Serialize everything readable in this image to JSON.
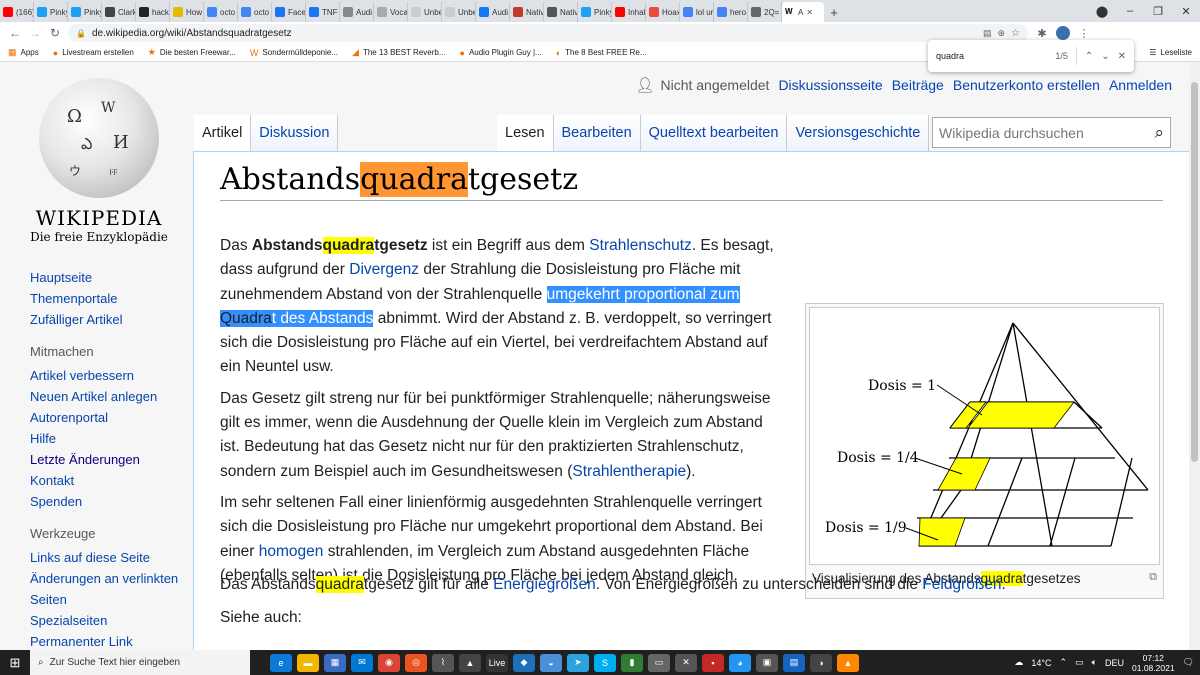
{
  "browser": {
    "tabs": [
      {
        "label": "(166)",
        "color": "#ff0000"
      },
      {
        "label": "Pinky",
        "color": "#1da1f2"
      },
      {
        "label": "Pinky",
        "color": "#1da1f2"
      },
      {
        "label": "Clark",
        "color": "#444444"
      },
      {
        "label": "hack",
        "color": "#222222"
      },
      {
        "label": "How",
        "color": "#e6b800"
      },
      {
        "label": "octo",
        "color": "#4285f4"
      },
      {
        "label": "octo",
        "color": "#4285f4"
      },
      {
        "label": "Faceb",
        "color": "#1877f2"
      },
      {
        "label": "TNF I",
        "color": "#1877f2"
      },
      {
        "label": "Audi",
        "color": "#888888"
      },
      {
        "label": "Vocal",
        "color": "#aaaaaa"
      },
      {
        "label": "Unbe",
        "color": "#cccccc"
      },
      {
        "label": "Unbe",
        "color": "#cccccc"
      },
      {
        "label": "Audi",
        "color": "#1877f2"
      },
      {
        "label": "Nativ",
        "color": "#c0392b"
      },
      {
        "label": "Nativ",
        "color": "#555555"
      },
      {
        "label": "Pinky",
        "color": "#1da1f2"
      },
      {
        "label": "Inhalt",
        "color": "#ff0000"
      },
      {
        "label": "Hoax",
        "color": "#e74c3c"
      },
      {
        "label": "lol ur",
        "color": "#4285f4"
      },
      {
        "label": "hero",
        "color": "#4285f4"
      },
      {
        "label": "2Q=",
        "color": "#666666"
      }
    ],
    "active_tab": {
      "label": "A",
      "icon": "W"
    },
    "url": "de.wikipedia.org/wiki/Abstandsquadratgesetz",
    "bookmarks": [
      {
        "label": "Apps",
        "icon": "▦"
      },
      {
        "label": "Livestream erstellen",
        "icon": "●"
      },
      {
        "label": "Die besten Freewar...",
        "icon": "★"
      },
      {
        "label": "Sondermülldeponie...",
        "icon": "W"
      },
      {
        "label": "The 13 BEST Reverb...",
        "icon": "◢"
      },
      {
        "label": "Audio Plugin Guy |...",
        "icon": "●"
      },
      {
        "label": "The 8 Best FREE Re...",
        "icon": "◐"
      }
    ],
    "reading_list": "Leseliste",
    "find": {
      "query": "quadra",
      "count": "1/5"
    }
  },
  "wiki": {
    "logo_title": "WIKIPEDIA",
    "logo_subtitle": "Die freie Enzyklopädie",
    "nav_main": [
      "Hauptseite",
      "Themenportale",
      "Zufälliger Artikel"
    ],
    "mitmachen_heading": "Mitmachen",
    "nav_mitmachen": [
      "Artikel verbessern",
      "Neuen Artikel anlegen",
      "Autorenportal",
      "Hilfe",
      "Letzte Änderungen",
      "Kontakt",
      "Spenden"
    ],
    "werkzeuge_heading": "Werkzeuge",
    "nav_werkzeuge": [
      "Links auf diese Seite",
      "Änderungen an verlinkten Seiten",
      "Spezialseiten",
      "Permanenter Link"
    ],
    "user": {
      "status": "Nicht angemeldet",
      "links": [
        "Diskussionsseite",
        "Beiträge",
        "Benutzerkonto erstellen",
        "Anmelden"
      ]
    },
    "tabs_left": [
      "Artikel",
      "Diskussion"
    ],
    "tabs_right": [
      "Lesen",
      "Bearbeiten",
      "Quelltext bearbeiten",
      "Versionsgeschichte"
    ],
    "search_placeholder": "Wikipedia durchsuchen",
    "title": {
      "pre": "Abstands",
      "hit": "quadra",
      "post": "tgesetz"
    }
  },
  "article": {
    "p1": {
      "a": "Das ",
      "b_pre": "Abstands",
      "b_hit": "quadra",
      "b_post": "tgesetz",
      "c": " ist ein Begriff aus dem ",
      "link1": "Strahlenschutz",
      "d": ". Es besagt, dass aufgrund der ",
      "link2": "Divergenz",
      "e": " der Strahlung die Dosisleistung pro Fläche mit zunehmendem Abstand von der Strahlenquelle ",
      "sel1": "umgekehrt proportional zum ",
      "sel_hit": "Quadra",
      "sel2": "t des Abstands",
      "f": " abnimmt. Wird der Abstand z. B. verdoppelt, so verringert sich die Dosisleistung pro Fläche auf ein Viertel, bei verdreifachtem Abstand auf ein Neuntel usw."
    },
    "p2": {
      "a": "Das Gesetz gilt streng nur für bei punktförmiger Strahlenquelle; näherungsweise gilt es immer, wenn die Ausdehnung der Quelle klein im Vergleich zum Abstand ist. Bedeutung hat das Gesetz nicht nur für den praktizierten Strahlenschutz, sondern zum Beispiel auch im Gesundheitswesen (",
      "link": "Strahlentherapie",
      "b": ")."
    },
    "p3": {
      "a": "Im sehr seltenen Fall einer linienförmig ausgedehnten Strahlenquelle verringert sich die Dosisleistung pro Fläche nur umgekehrt proportional dem Abstand. Bei einer ",
      "link": "homogen",
      "b": " strahlenden, im Vergleich zum Abstand ausgedehnten Fläche (ebenfalls selten) ist die Dosisleistung pro Fläche bei jedem Abstand gleich."
    },
    "p4": {
      "a": "Das Abstands",
      "hit": "quadra",
      "b": "tgesetz gilt für alle ",
      "link1": "Energiegrößen",
      "c": ". Von Energiegrößen zu unterscheiden sind die ",
      "link2": "Feldgrößen",
      "d": "."
    },
    "siehe": "Siehe auch:",
    "figure": {
      "labels": [
        "Dosis = 1",
        "Dosis = 1/4",
        "Dosis = 1/9"
      ],
      "caption_pre": "Visualisierung des Abstands",
      "caption_hit": "quadra",
      "caption_post": "tgesetzes",
      "fill": "#ffff00"
    }
  },
  "taskbar": {
    "search_placeholder": "Zur Suche Text hier eingeben",
    "weather": "14°C",
    "lang": "DEU",
    "time": "07:12",
    "date": "01.08.2021",
    "apps": [
      {
        "name": "edge",
        "color": "#0c7bd8",
        "glyph": "e"
      },
      {
        "name": "explorer",
        "color": "#f2b500",
        "glyph": "▬"
      },
      {
        "name": "store",
        "color": "#3a6bc4",
        "glyph": "▦"
      },
      {
        "name": "mail",
        "color": "#0078d4",
        "glyph": "✉"
      },
      {
        "name": "chrome",
        "color": "#db4437",
        "glyph": "◉"
      },
      {
        "name": "ubuntu",
        "color": "#e95420",
        "glyph": "◎"
      },
      {
        "name": "app7",
        "color": "#555555",
        "glyph": "⌇"
      },
      {
        "name": "app8",
        "color": "#444444",
        "glyph": "▲"
      },
      {
        "name": "live",
        "color": "#333333",
        "glyph": "Live"
      },
      {
        "name": "app10",
        "color": "#1d6fb8",
        "glyph": "◆"
      },
      {
        "name": "app11",
        "color": "#4a90d9",
        "glyph": "◒"
      },
      {
        "name": "telegram",
        "color": "#2aa3de",
        "glyph": "➤"
      },
      {
        "name": "skype",
        "color": "#00aff0",
        "glyph": "S"
      },
      {
        "name": "app14",
        "color": "#2e7d32",
        "glyph": "▮"
      },
      {
        "name": "app15",
        "color": "#666666",
        "glyph": "▭"
      },
      {
        "name": "app16",
        "color": "#555555",
        "glyph": "✕"
      },
      {
        "name": "app17",
        "color": "#c62828",
        "glyph": "▪"
      },
      {
        "name": "app18",
        "color": "#2196f3",
        "glyph": "◕"
      },
      {
        "name": "app19",
        "color": "#555555",
        "glyph": "▣"
      },
      {
        "name": "app20",
        "color": "#1565c0",
        "glyph": "▤"
      },
      {
        "name": "app21",
        "color": "#444444",
        "glyph": "◑"
      },
      {
        "name": "vlc",
        "color": "#ff8800",
        "glyph": "▲"
      }
    ]
  }
}
